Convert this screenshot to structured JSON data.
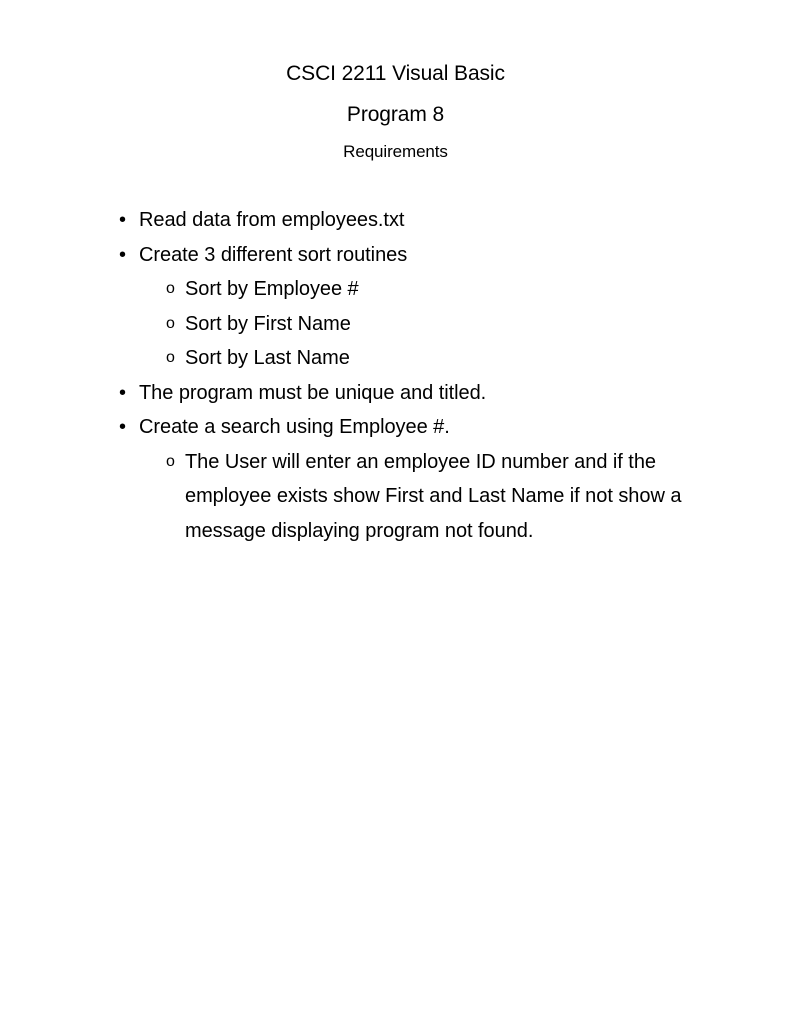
{
  "document": {
    "title": "CSCI 2211 Visual Basic",
    "subtitle": "Program 8",
    "section_label": "Requirements",
    "text_color": "#000000",
    "background_color": "#ffffff",
    "markers": {
      "level1_bullet": "•",
      "level2_bullet": "o"
    },
    "requirements": [
      {
        "level": 1,
        "text": "Read data from employees.txt"
      },
      {
        "level": 1,
        "text": "Create 3 different sort routines"
      },
      {
        "level": 2,
        "text": "Sort by Employee #"
      },
      {
        "level": 2,
        "text": "Sort by First Name"
      },
      {
        "level": 2,
        "text": "Sort by Last Name"
      },
      {
        "level": 1,
        "text": "The program must be unique and titled."
      },
      {
        "level": 1,
        "text": "Create a search using Employee #."
      },
      {
        "level": 2,
        "text": "The User will enter an employee ID number and if the employee exists show First and Last Name if not show a message displaying program not found."
      }
    ]
  }
}
